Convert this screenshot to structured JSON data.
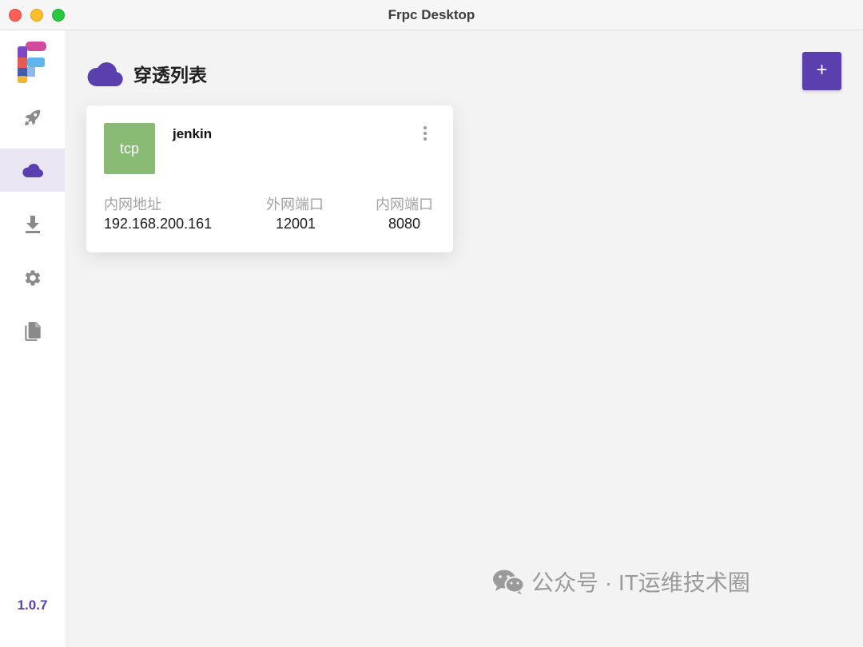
{
  "window": {
    "title": "Frpc Desktop"
  },
  "sidebar": {
    "items": [
      {
        "id": "rocket",
        "icon": "rocket-icon",
        "active": false
      },
      {
        "id": "proxies",
        "icon": "cloud-icon",
        "active": true
      },
      {
        "id": "download",
        "icon": "download-icon",
        "active": false
      },
      {
        "id": "settings",
        "icon": "gear-icon",
        "active": false
      },
      {
        "id": "logs",
        "icon": "documents-icon",
        "active": false
      }
    ],
    "version": "1.0.7"
  },
  "header": {
    "title": "穿透列表",
    "add_label": "+"
  },
  "proxies": [
    {
      "type": "tcp",
      "name": "jenkin",
      "fields": [
        {
          "label": "内网地址",
          "value": "192.168.200.161"
        },
        {
          "label": "外网端口",
          "value": "12001"
        },
        {
          "label": "内网端口",
          "value": "8080"
        }
      ]
    }
  ],
  "watermark": {
    "text": "公众号 · IT运维技术圈"
  },
  "colors": {
    "accent": "#5b3fae",
    "tcp_badge": "#89bb75",
    "nav_icon": "#8a8a8a",
    "active_bg": "#ebe6f3"
  }
}
